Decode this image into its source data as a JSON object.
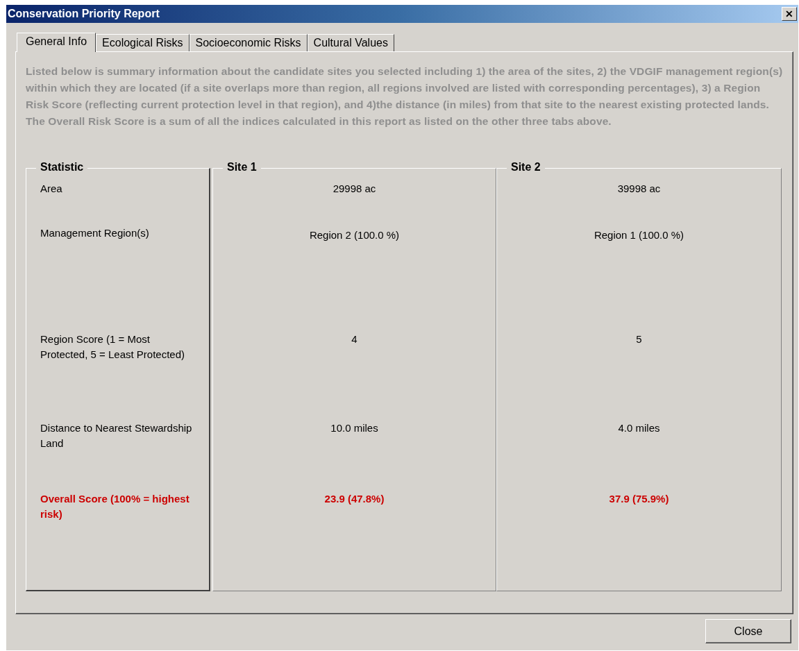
{
  "window": {
    "title": "Conservation Priority Report",
    "close_glyph": "✕"
  },
  "tabs": [
    {
      "label": "General Info",
      "selected": true
    },
    {
      "label": "Ecological Risks",
      "selected": false
    },
    {
      "label": "Socioeconomic Risks",
      "selected": false
    },
    {
      "label": "Cultural Values",
      "selected": false
    }
  ],
  "description": "Listed below is summary information about the candidate sites you selected including 1) the area of the sites, 2) the VDGIF management region(s) within which they are located (if a site overlaps more than region, all regions involved are listed with corresponding percentages), 3) a Region Risk Score (reflecting current protection level in that region), and 4)the distance (in miles) from that site to the nearest existing protected lands.  The Overall Risk Score is a sum of all the indices calculated in this report as listed on the other three tabs above.",
  "statistic_header": "Statistic",
  "sites": [
    "Site 1",
    "Site 2"
  ],
  "rows": [
    {
      "label": "Area",
      "kind": "normal",
      "values": [
        "29998 ac",
        "39998 ac"
      ]
    },
    {
      "label": "Management Region(s)",
      "kind": "normal",
      "values": [
        "Region 2 (100.0 %)",
        "Region 1 (100.0 %)"
      ]
    },
    {
      "label": "Region Score (1 = Most Protected, 5 = Least Protected)",
      "kind": "normal",
      "values": [
        "4",
        "5"
      ]
    },
    {
      "label": "Distance to Nearest Stewardship Land",
      "kind": "normal",
      "values": [
        "10.0 miles",
        "4.0 miles"
      ]
    },
    {
      "label": "Overall Score (100% = highest risk)",
      "kind": "highlight",
      "values": [
        "23.9 (47.8%)",
        "37.9 (75.9%)"
      ]
    }
  ],
  "buttons": [
    "Close"
  ]
}
